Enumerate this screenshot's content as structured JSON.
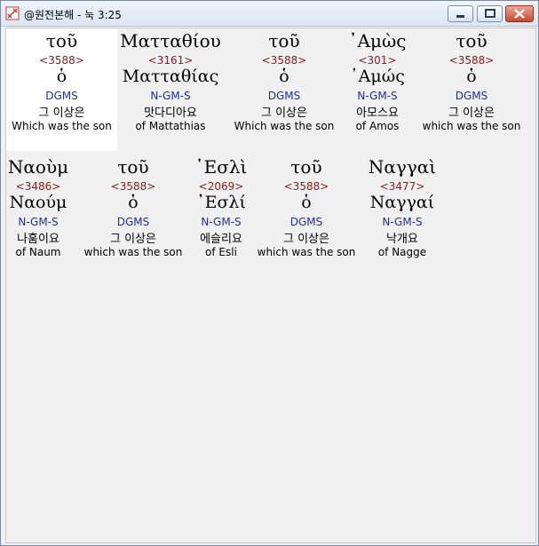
{
  "window": {
    "title": "@원전본해 - 눅 3:25"
  },
  "rows": [
    [
      {
        "greek": "τοῦ",
        "strongs": "<3588>",
        "lemma": "ὁ",
        "morph": "DGMS",
        "korean": "그 이상은",
        "english": "Which was the son"
      },
      {
        "greek": "Ματταθίου",
        "strongs": "<3161>",
        "lemma": "Ματταθίας",
        "morph": "N-GM-S",
        "korean": "맛다디아요",
        "english": "of Mattathias"
      },
      {
        "greek": "τοῦ",
        "strongs": "<3588>",
        "lemma": "ὁ",
        "morph": "DGMS",
        "korean": "그 이상은",
        "english": "Which was the son"
      },
      {
        "greek": "᾿Αμὼς",
        "strongs": "<301>",
        "lemma": "᾿Αμώς",
        "morph": "N-GM-S",
        "korean": "아모스요",
        "english": "of Amos"
      },
      {
        "greek": "τοῦ",
        "strongs": "<3588>",
        "lemma": "ὁ",
        "morph": "DGMS",
        "korean": "그 이상은",
        "english": "which was the son"
      }
    ],
    [
      {
        "greek": "Ναοὺμ",
        "strongs": "<3486>",
        "lemma": "Ναούμ",
        "morph": "N-GM-S",
        "korean": "나훔이요",
        "english": "of Naum"
      },
      {
        "greek": "τοῦ",
        "strongs": "<3588>",
        "lemma": "ὁ",
        "morph": "DGMS",
        "korean": "그 이상은",
        "english": "which was the son"
      },
      {
        "greek": "῾Εσλὶ",
        "strongs": "<2069>",
        "lemma": "᾿Εσλί",
        "morph": "N-GM-S",
        "korean": "에슬리요",
        "english": "of Esli"
      },
      {
        "greek": "τοῦ",
        "strongs": "<3588>",
        "lemma": "ὁ",
        "morph": "DGMS",
        "korean": "그 이상은",
        "english": "which was the son"
      },
      {
        "greek": "Ναγγαὶ",
        "strongs": "<3477>",
        "lemma": "Ναγγαί",
        "morph": "N-GM-S",
        "korean": "낙개요",
        "english": "of Nagge"
      }
    ]
  ]
}
